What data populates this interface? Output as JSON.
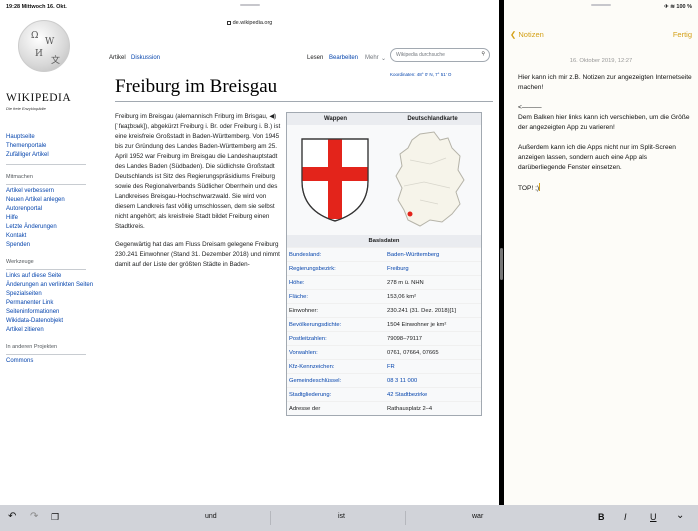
{
  "status_bar": {
    "time_date": "19:28  Mittwoch 16. Okt.",
    "right": "✈ ≋ 100 %"
  },
  "browser": {
    "url": "de.wikipedia.org"
  },
  "logo": {
    "wordmark": "WIKIPEDIA",
    "tagline": "Die freie Enzyklopädie"
  },
  "sidebar": {
    "main": [
      "Hauptseite",
      "Themenportale",
      "Zufälliger Artikel"
    ],
    "mitmachen_head": "Mitmachen",
    "mitmachen": [
      "Artikel verbessern",
      "Neuen Artikel anlegen",
      "Autorenportal",
      "Hilfe",
      "Letzte Änderungen",
      "Kontakt",
      "Spenden"
    ],
    "werkzeuge_head": "Werkzeuge",
    "werkzeuge": [
      "Links auf diese Seite",
      "Änderungen an verlinkten Seiten",
      "Spezialseiten",
      "Permanenter Link",
      "Seiteninformationen",
      "Wikidata-Datenobjekt",
      "Artikel zitieren"
    ],
    "projekte_head": "In anderen Projekten",
    "projekte": [
      "Commons"
    ]
  },
  "tabs": {
    "artikel": "Artikel",
    "diskussion": "Diskussion",
    "lesen": "Lesen",
    "bearbeiten": "Bearbeiten",
    "mehr": "Mehr",
    "search_placeholder": "Wikipedia durchsuche"
  },
  "coordinates": "Koordinaten: 48° 0′ N, 7° 51′ O",
  "title": "Freiburg im Breisgau",
  "article": {
    "p1": "Freiburg im Breisgau (alemannisch Friburg im Brisgau, ◀) [ˈfʁaɪ̯bʊʁk]), abgekürzt Freiburg i. Br. oder Freiburg i. B.) ist eine kreisfreie Großstadt in Baden-Württemberg. Von 1945 bis zur Gründung des Landes Baden-Württemberg am 25. April 1952 war Freiburg im Breisgau die Landeshauptstadt des Landes Baden (Südbaden). Die südlichste Großstadt Deutschlands ist Sitz des Regierungspräsidiums Freiburg sowie des Regionalverbands Südlicher Oberrhein und des Landkreises Breisgau-Hochschwarzwald. Sie wird von diesem Landkreis fast völlig umschlossen, dem sie selbst nicht angehört; als kreisfreie Stadt bildet Freiburg einen Stadtkreis.",
    "p2": "Gegenwärtig hat das am Fluss Dreisam gelegene Freiburg 230.241 Einwohner (Stand 31. Dezember 2018) und nimmt damit auf der Liste der größten Städte in Baden-"
  },
  "infobox": {
    "head_left": "Wappen",
    "head_right": "Deutschlandkarte",
    "section": "Basisdaten",
    "rows": [
      {
        "k": "Bundesland:",
        "v": "Baden-Württemberg"
      },
      {
        "k": "Regierungsbezirk:",
        "v": "Freiburg"
      },
      {
        "k": "Höhe:",
        "v": "278 m ü. NHN"
      },
      {
        "k": "Fläche:",
        "v": "153,06 km²"
      },
      {
        "k": "Einwohner:",
        "v": "230.241 (31. Dez. 2018)[1]"
      },
      {
        "k": "Bevölkerungsdichte:",
        "v": "1504 Einwohner je km²"
      },
      {
        "k": "Postleitzahlen:",
        "v": "79098–79117"
      },
      {
        "k": "Vorwahlen:",
        "v": "0761, 07664, 07665"
      },
      {
        "k": "Kfz-Kennzeichen:",
        "v": "FR"
      },
      {
        "k": "Gemeindeschlüssel:",
        "v": "08 3 11 000"
      },
      {
        "k": "Stadtgliederung:",
        "v": "42 Stadtbezirke"
      },
      {
        "k": "Adresse der",
        "v": "Rathausplatz 2–4"
      }
    ]
  },
  "notes": {
    "back": "Notizen",
    "done": "Fertig",
    "date": "16. Oktober 2019, 12:27",
    "p1": "Hier kann ich mir z.B. Notizen zur angezeigten Internetseite machen!",
    "arrow": "<———",
    "p2": "Dem Balken hier links kann ich verschieben, um die Größe der angezeigten App zu varieren!",
    "p3": "Außerdem kann ich die Apps nicht nur im Split-Screen anzeigen lassen, sondern auch eine App als darüberliegende Fenster einsetzen.",
    "p4": "TOP! ;)"
  },
  "keyboard_bar": {
    "s1": "und",
    "s2": "ist",
    "s3": "war",
    "bold": "B",
    "italic": "I",
    "underline": "U"
  }
}
